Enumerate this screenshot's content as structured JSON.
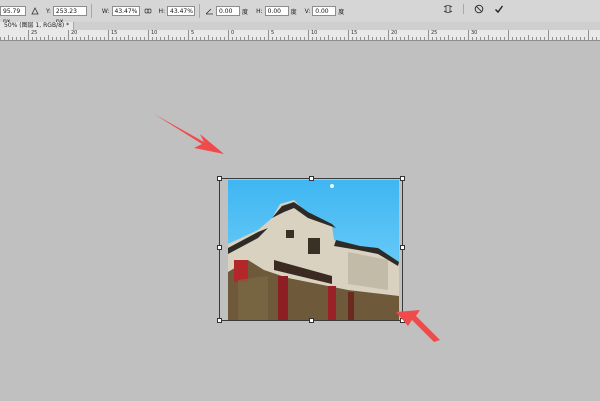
{
  "options_bar": {
    "x_value": "95.79 px",
    "y_label": "Y:",
    "y_value": "253.23 px",
    "w_label": "W:",
    "w_value": "43.47%",
    "h_label": "H:",
    "h_value": "43.47%",
    "angle_value": "0.00",
    "angle_unit": "度",
    "hskew_label": "H:",
    "hskew_value": "0.00",
    "hskew_unit": "度",
    "vskew_label": "V:",
    "vskew_value": "0.00",
    "vskew_unit": "度",
    "icons": [
      "reference-point-icon",
      "link-icon",
      "angle-icon",
      "warp-icon",
      "cancel-icon",
      "commit-icon"
    ]
  },
  "document": {
    "tab_title": "50% (图层 1, RGB/8) *"
  },
  "ruler": {
    "labels": [
      "25",
      "20",
      "15",
      "10",
      "5",
      "0",
      "5",
      "10",
      "15",
      "20",
      "25",
      "30"
    ]
  },
  "colors": {
    "canvas": "#c0c0c0",
    "arrow": "#f04a4a",
    "sky": "#55c6f5"
  }
}
